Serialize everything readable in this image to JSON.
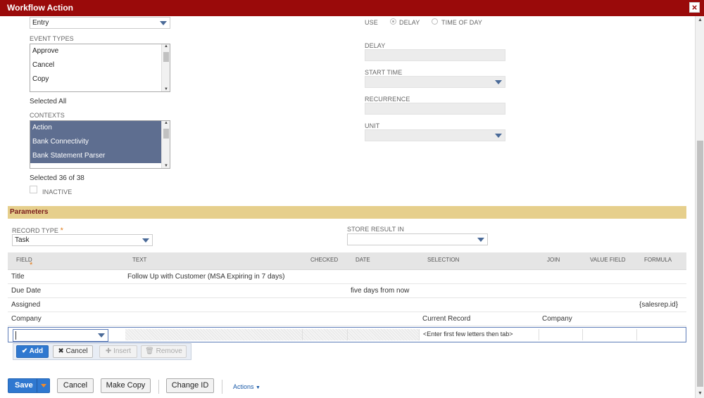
{
  "window": {
    "title": "Workflow Action",
    "close_glyph": "×"
  },
  "trigger": {
    "value": "Entry"
  },
  "event_types": {
    "label": "EVENT TYPES",
    "options": [
      "Approve",
      "Cancel",
      "Copy"
    ],
    "summary": "Selected All"
  },
  "contexts": {
    "label": "CONTEXTS",
    "options": [
      "Action",
      "Bank Connectivity",
      "Bank Statement Parser"
    ],
    "summary": "Selected 36 of 38"
  },
  "inactive": {
    "label": "INACTIVE"
  },
  "schedule": {
    "use_label": "USE",
    "delay_radio_label": "DELAY",
    "time_of_day_radio_label": "TIME OF DAY",
    "delay_label": "DELAY",
    "start_time_label": "START TIME",
    "recurrence_label": "RECURRENCE",
    "unit_label": "UNIT"
  },
  "parameters": {
    "title": "Parameters",
    "record_type_label": "RECORD TYPE",
    "required_mark": "*",
    "record_type_value": "Task",
    "store_result_label": "STORE RESULT IN"
  },
  "grid": {
    "headers": [
      "FIELD",
      "TEXT",
      "CHECKED",
      "DATE",
      "SELECTION",
      "JOIN",
      "VALUE FIELD",
      "FORMULA"
    ],
    "rows": [
      {
        "field": "Title",
        "text": "Follow Up with Customer (MSA Expiring in 7 days)",
        "date": "",
        "selection": "",
        "join": "",
        "formula": ""
      },
      {
        "field": "Due Date",
        "text": "",
        "date": "five days from now",
        "selection": "",
        "join": "",
        "formula": ""
      },
      {
        "field": "Assigned",
        "text": "",
        "date": "",
        "selection": "",
        "join": "",
        "formula": "{salesrep.id}"
      },
      {
        "field": "Company",
        "text": "",
        "date": "",
        "selection": "Current Record",
        "join": "Company",
        "formula": ""
      }
    ],
    "edit_row": {
      "selection_hint": "<Enter first few letters then tab>"
    },
    "buttons": {
      "add": "Add",
      "cancel": "Cancel",
      "insert": "Insert",
      "remove": "Remove"
    }
  },
  "footer": {
    "save": "Save",
    "cancel": "Cancel",
    "make_copy": "Make Copy",
    "change_id": "Change ID",
    "actions": "Actions"
  },
  "colors": {
    "title_bar": "#9a0a0a",
    "section_header": "#e6cf8c",
    "primary_button": "#2f78d0",
    "selected_list": "#5e6e90"
  }
}
